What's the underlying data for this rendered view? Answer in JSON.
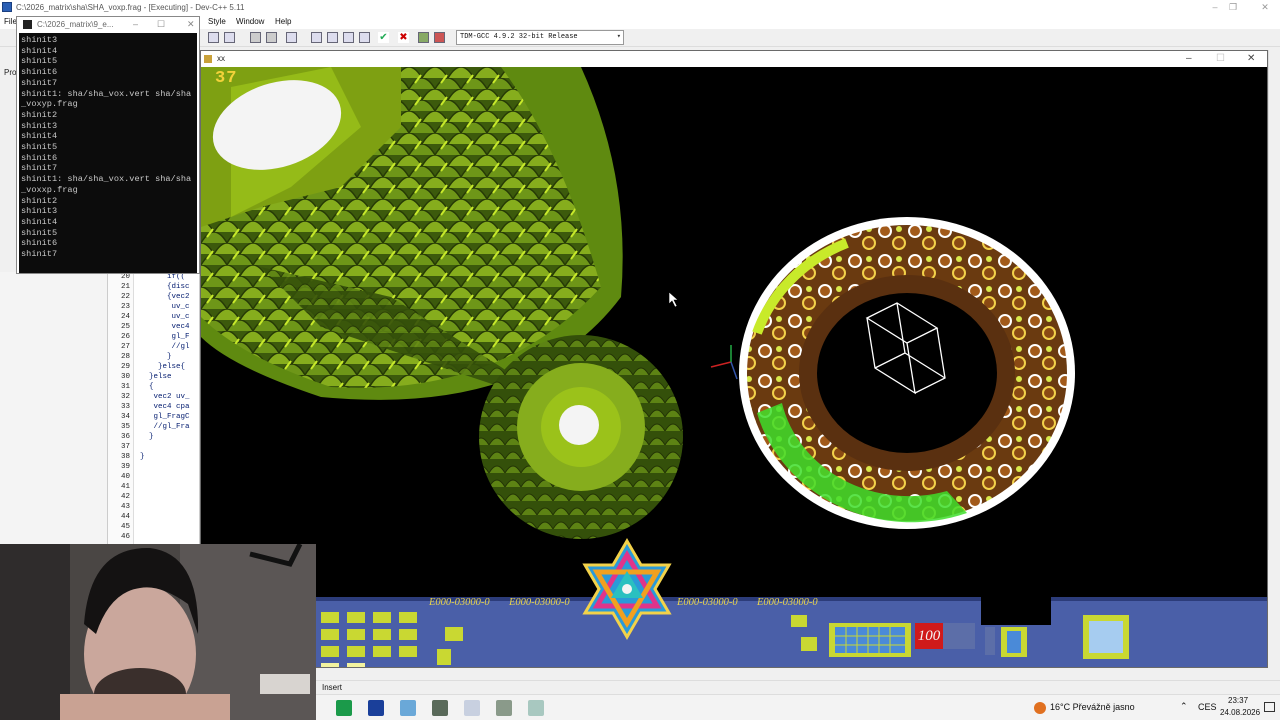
{
  "devcpp": {
    "title": "C:\\2026_matrix\\sha\\SHA_voxp.frag - [Executing] - Dev-C++ 5.11",
    "menu": [
      "File",
      "Style",
      "Window",
      "Help"
    ],
    "compiler": "TDM-GCC 4.9.2 32-bit Release",
    "project_tab": "Pro",
    "line_numbers": [
      "20",
      "21",
      "22",
      "23",
      "24",
      "25",
      "26",
      "27",
      "28",
      "29",
      "30",
      "31",
      "32",
      "33",
      "34",
      "35",
      "36",
      "37",
      "38",
      "39",
      "40",
      "41",
      "42",
      "43",
      "44",
      "45",
      "46"
    ],
    "code_lines": [
      "      if((",
      "      {disc",
      "      {vec2",
      "       uv_c",
      "       uv_c",
      "       vec4",
      "       gl_F",
      "       //gl",
      "      }",
      "    }else{",
      "  }else",
      "  {",
      "   vec2 uv_",
      "   vec4 cpa",
      "   gl_FragC",
      "   //gl_Fra",
      "  }",
      "",
      "}",
      "",
      "",
      "",
      "",
      "",
      "",
      "",
      ""
    ]
  },
  "console": {
    "title": "C:\\2026_matrix\\9_e...",
    "lines": [
      "shinit3",
      "shinit4",
      "shinit5",
      "shinit6",
      "shinit7",
      "shinit1: sha/sha_vox.vert sha/sha",
      "_voxyp.frag",
      "shinit2",
      "shinit3",
      "shinit4",
      "shinit5",
      "shinit6",
      "shinit7",
      "shinit1: sha/sha_vox.vert sha/sha",
      "_voxxp.frag",
      "shinit2",
      "shinit3",
      "shinit4",
      "shinit5",
      "shinit6",
      "shinit7"
    ]
  },
  "gl_window": {
    "title": "xx",
    "fps": "37"
  },
  "hud": {
    "readouts": [
      "E000-03000-0",
      "E000-03000-0",
      "E000-03000-0",
      "E000-03000-0"
    ],
    "counter": "100"
  },
  "statusbar": {
    "mode": "Insert"
  },
  "taskbar": {
    "weather": "16°C  Převážně jasno",
    "lang": "CES",
    "time": "23:37",
    "date": "24.08.2026"
  },
  "colors": {
    "hud_panel": "#4a5fa8",
    "hud_text": "#e9d44c",
    "counter_bg": "#d01a1a",
    "cone_green": "#9bc21a",
    "torus_brown": "#6a3a10"
  }
}
